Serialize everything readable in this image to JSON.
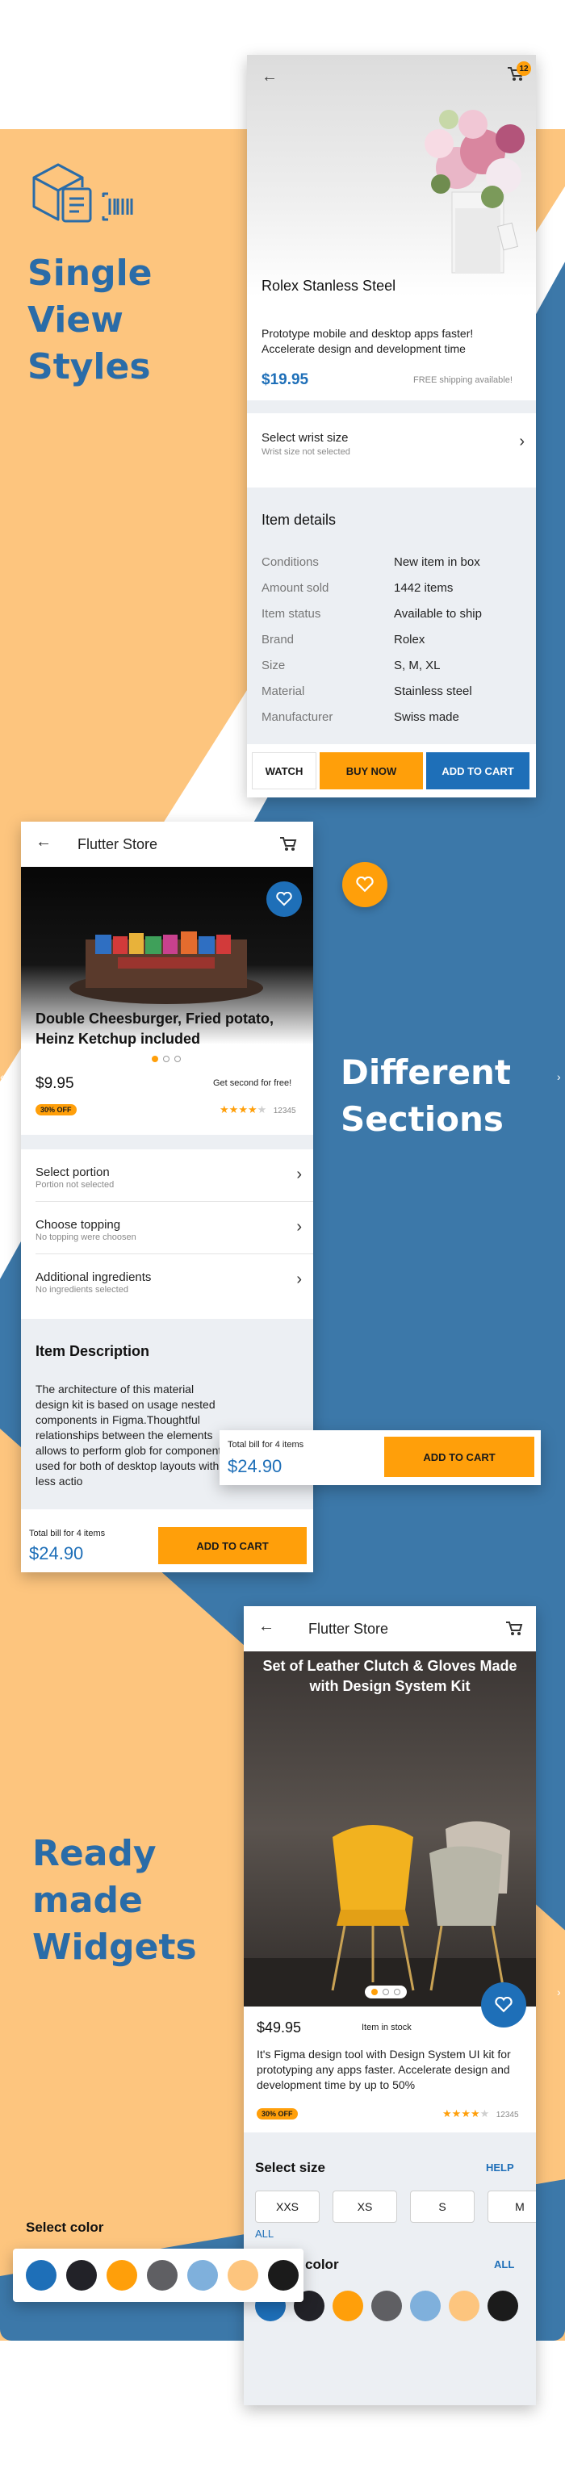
{
  "headings": {
    "single_view": [
      "Single",
      "View",
      "Styles"
    ],
    "different_sections": [
      "Different",
      "Sections"
    ],
    "ready_made": [
      "Ready",
      "made",
      "Widgets"
    ]
  },
  "screen1": {
    "cart_count": "12",
    "title": "Rolex Stanless Steel",
    "description": "Prototype mobile and desktop apps faster! Accelerate design and development time",
    "price": "$19.95",
    "shipping": "FREE shipping available!",
    "select_title": "Select wrist size",
    "select_sub": "Wrist size not selected",
    "details_title": "Item details",
    "details": [
      {
        "k": "Conditions",
        "v": "New item in box"
      },
      {
        "k": "Amount sold",
        "v": "1442 items"
      },
      {
        "k": "Item status",
        "v": "Available to ship"
      },
      {
        "k": "Brand",
        "v": "Rolex"
      },
      {
        "k": "Size",
        "v": "S, M, XL"
      },
      {
        "k": "Material",
        "v": "Stainless steel"
      },
      {
        "k": "Manufacturer",
        "v": "Swiss made"
      }
    ],
    "btn_watch": "WATCH",
    "btn_buy": "BUY NOW",
    "btn_add": "ADD TO CART"
  },
  "screen2": {
    "app_title": "Flutter Store",
    "product_title": "Double Cheesburger, Fried potato, Heinz Ketchup included",
    "price": "$9.95",
    "promo": "Get second for free!",
    "badge": "30% OFF",
    "rating_count": "12345",
    "options": [
      {
        "label": "Select portion",
        "sub": "Portion not selected"
      },
      {
        "label": "Choose topping",
        "sub": "No topping were choosen"
      },
      {
        "label": "Additional ingredients",
        "sub": "No ingredients selected"
      }
    ],
    "desc_title": "Item Description",
    "desc_text": "The architecture of this material design kit is based on usage nested components in Figma.Thoughtful relationships between the elements allows to perform glob for components used for both of desktop layouts within less actio",
    "bill_label": "Total bill for 4 items",
    "bill_total": "$24.90",
    "btn_add": "ADD TO CART"
  },
  "float_bill": {
    "label": "Total bill for 4 items",
    "total": "$24.90",
    "btn": "ADD TO CART"
  },
  "screen3": {
    "app_title": "Flutter Store",
    "hero_title": "Set of Leather Clutch & Gloves Made with Design System Kit",
    "price": "$49.95",
    "stock": "Item in stock",
    "description": "It's Figma design tool with Design System UI kit for prototyping any apps faster. Accelerate design and development time by up to 50%",
    "badge": "30% OFF",
    "rating_count": "12345",
    "size_title": "Select size",
    "size_help": "HELP",
    "sizes": [
      "XXS",
      "XS",
      "S",
      "M"
    ],
    "all_link": "ALL",
    "color_title": "color",
    "color_all": "ALL"
  },
  "float_color": {
    "title": "Select color"
  },
  "colors": {
    "brand_blue": "#1E6FB8",
    "accent_orange": "#FF9F0A",
    "bg_orange": "#FDC57E",
    "bg_blue": "#3C78A9",
    "swatches": [
      "#1E6FB8",
      "#222228",
      "#FF9F0A",
      "#5F5F63",
      "#7FB0DC",
      "#FDC57E",
      "#1b1b1b"
    ]
  }
}
